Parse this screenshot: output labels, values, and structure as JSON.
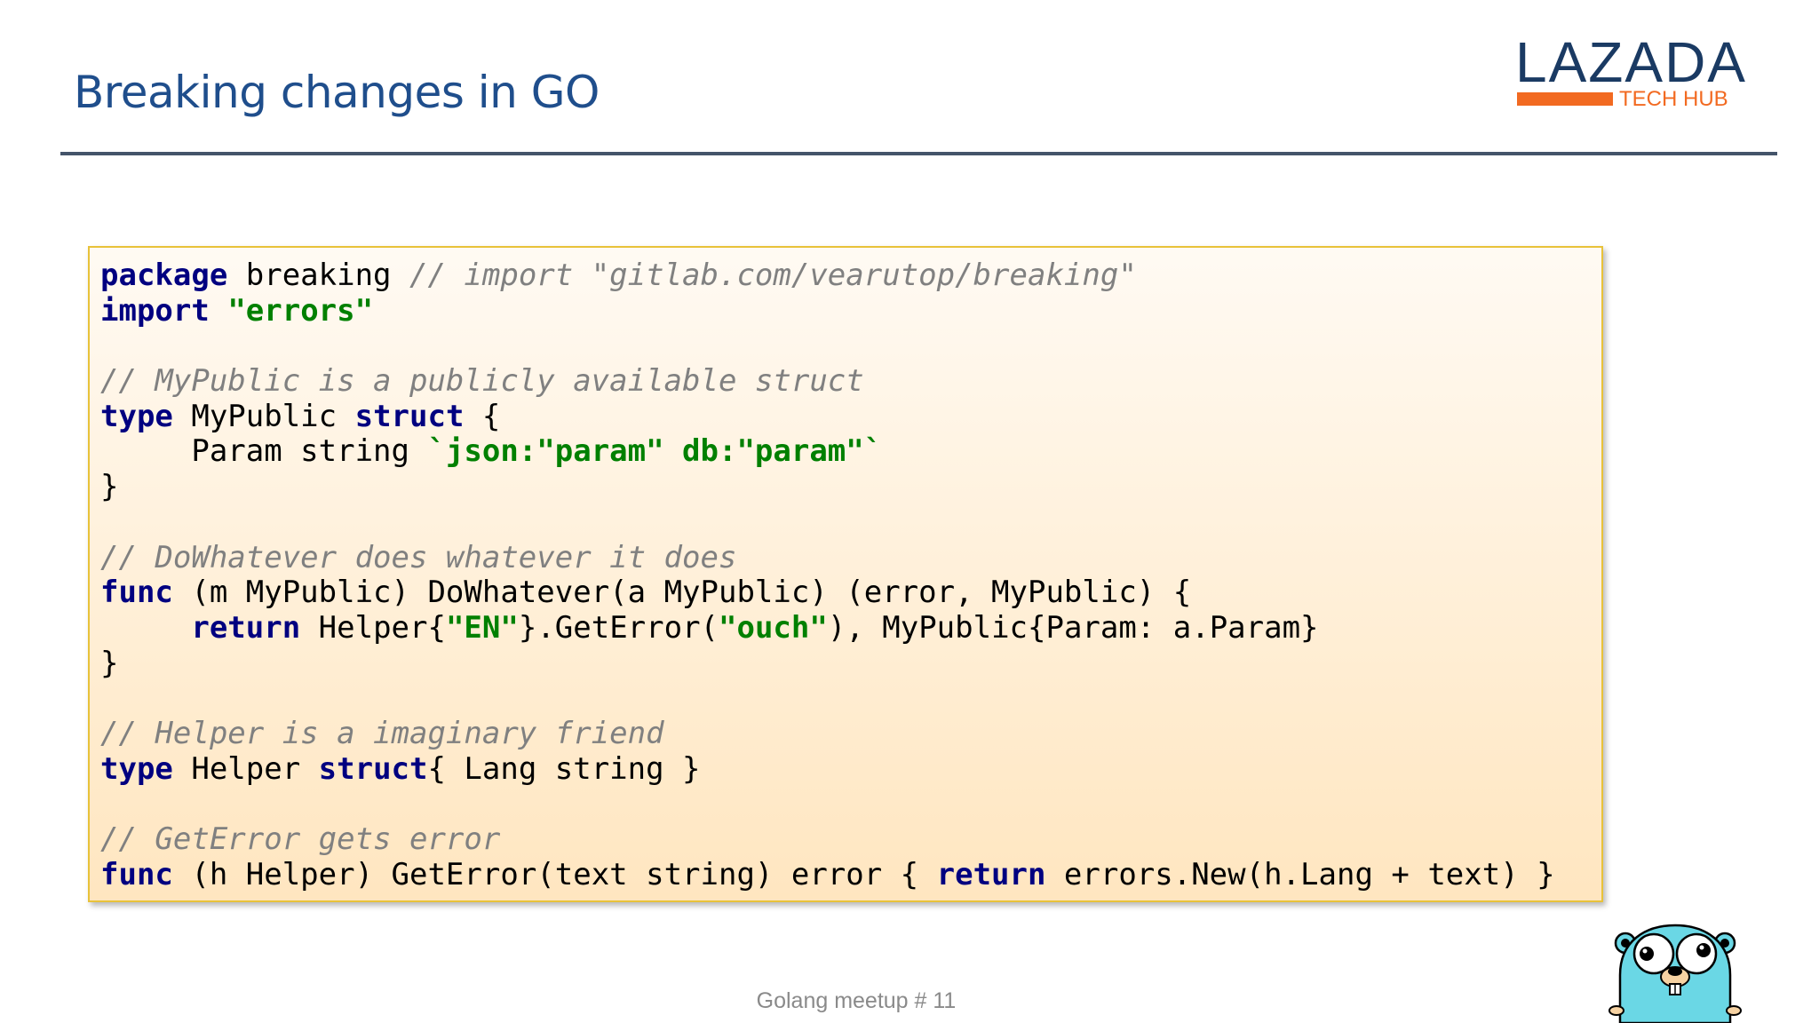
{
  "slide": {
    "title": "Breaking changes in GO",
    "footer": "Golang meetup # 11"
  },
  "logo": {
    "word": "LAZADA",
    "sub": "TECH HUB",
    "bar_color": "#f26a21",
    "word_color": "#1a3a63"
  },
  "code": {
    "l1": {
      "kw": "package",
      "txt": " breaking ",
      "cm": "// import \"gitlab.com/vearutop/breaking\""
    },
    "l2": {
      "kw": "import",
      "txt": " ",
      "str": "\"errors\""
    },
    "l4": {
      "cm": "// MyPublic is a publicly available struct"
    },
    "l5": {
      "kw1": "type",
      "txt1": " MyPublic ",
      "kw2": "struct",
      "txt2": " {"
    },
    "l6": {
      "txt": "     Param string ",
      "str": "`json:\"param\" db:\"param\"`"
    },
    "l7": {
      "txt": "}"
    },
    "l9": {
      "cm": "// DoWhatever does whatever it does"
    },
    "l10": {
      "kw": "func",
      "txt": " (m MyPublic) DoWhatever(a MyPublic) (error, MyPublic) {"
    },
    "l11": {
      "indent": "     ",
      "kw": "return",
      "t1": " Helper{",
      "s1": "\"EN\"",
      "t2": "}.GetError(",
      "s2": "\"ouch\"",
      "t3": "), MyPublic{Param: a.Param}"
    },
    "l12": {
      "txt": "}"
    },
    "l14": {
      "cm": "// Helper is a imaginary friend"
    },
    "l15": {
      "kw1": "type",
      "txt1": " Helper ",
      "kw2": "struct",
      "txt2": "{ Lang string }"
    },
    "l17": {
      "cm": "// GetError gets error"
    },
    "l18": {
      "kw1": "func",
      "txt1": " (h Helper) GetError(text string) error { ",
      "kw2": "return",
      "txt2": " errors.New(h.Lang + text) }"
    }
  },
  "colors": {
    "title": "#1f4e8c",
    "keyword": "#000080",
    "string": "#008000",
    "comment": "#808080",
    "code_border": "#e8c23a"
  },
  "icons": [
    "lazada-tech-hub-logo",
    "go-gopher-mascot"
  ]
}
